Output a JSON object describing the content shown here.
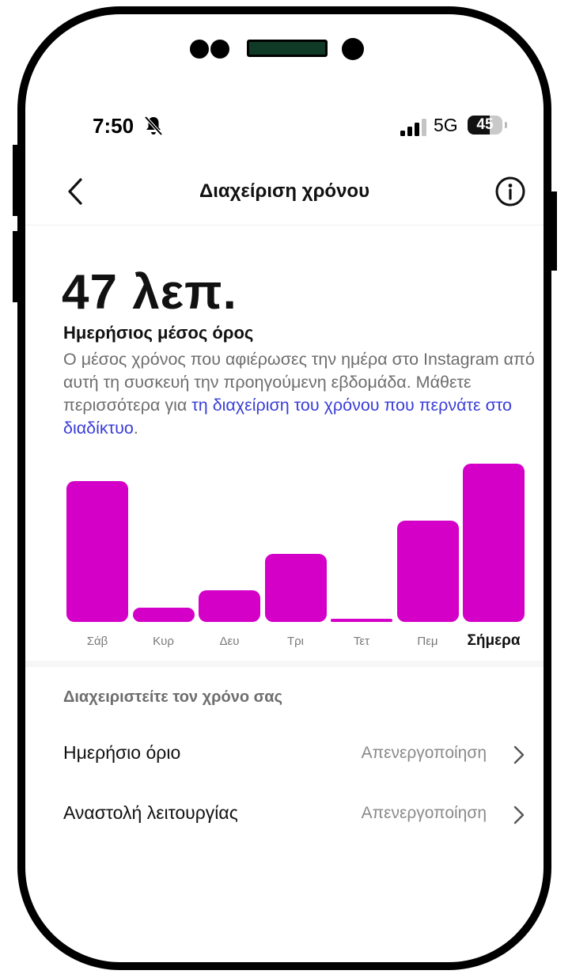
{
  "status_bar": {
    "time": "7:50",
    "network": "5G",
    "battery": "45"
  },
  "header": {
    "title": "Διαχείριση χρόνου"
  },
  "summary": {
    "value": "47 λεπ.",
    "subtitle": "Ημερήσιος μέσος όρος",
    "description": "Ο μέσος χρόνος που αφιέρωσες την ημέρα στο Instagram από αυτή τη συσκευή την προηγούμενη εβδομάδα. Μάθετε περισσότερα για ",
    "link_text": "τη διαχείριση του χρόνου που περνάτε στο διαδίκτυο",
    "link_suffix": "."
  },
  "chart_data": {
    "type": "bar",
    "categories": [
      "Σάβ",
      "Κυρ",
      "Δευ",
      "Τρι",
      "Τετ",
      "Πεμ",
      "Σήμερα"
    ],
    "values": [
      0.89,
      0.09,
      0.2,
      0.43,
      0.02,
      0.64,
      1.0
    ],
    "title": "",
    "xlabel": "",
    "ylabel": "",
    "grid": false,
    "bar_color": "#d400c8",
    "highlight_category": "Σήμερα"
  },
  "manage": {
    "section_title": "Διαχειριστείτε τον χρόνο σας",
    "rows": [
      {
        "label": "Ημερήσιο όριο",
        "value": "Απενεργοποίηση"
      },
      {
        "label": "Αναστολή λειτουργίας",
        "value": "Απενεργοποίηση"
      }
    ]
  },
  "icons": {
    "back": "chevron-left-icon",
    "info": "info-circle-icon",
    "bell": "bell-slash-icon",
    "signal": "signal-bars-icon",
    "row_chevron": "chevron-right-icon"
  },
  "colors": {
    "accent": "#d400c8",
    "link": "#3a3ed6"
  }
}
